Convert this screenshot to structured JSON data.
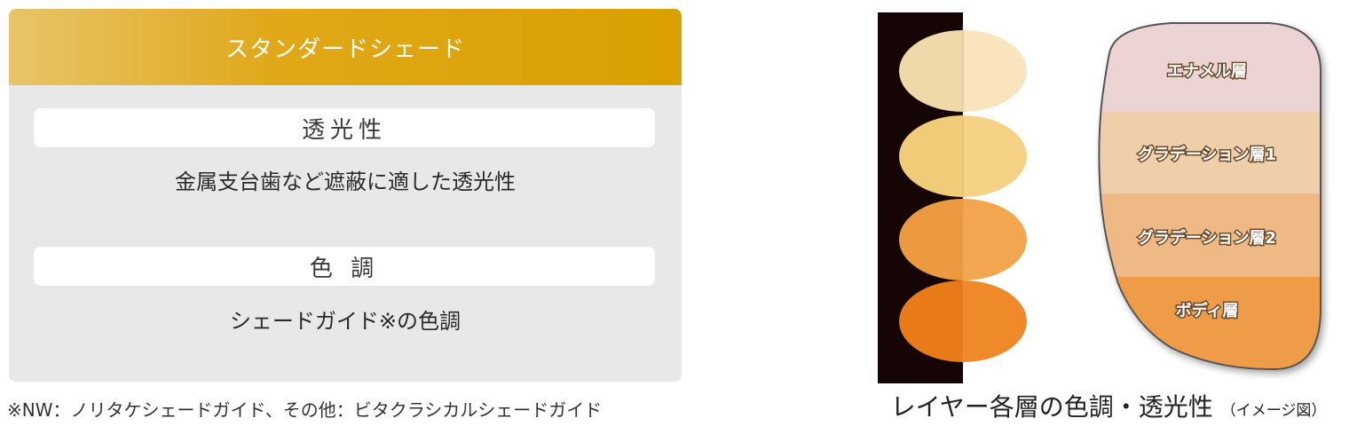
{
  "card": {
    "header": "スタンダードシェード",
    "sections": [
      {
        "label": "透光性",
        "description": "金属支台歯など遮蔽に適した透光性"
      },
      {
        "label": "色 調",
        "description": "シェードガイド※の色調"
      }
    ]
  },
  "footnote": "※NW：ノリタケシェードガイド、その他：ビタクラシカルシェードガイド",
  "diagram": {
    "layers": [
      "エナメル層",
      "グラデーション層1",
      "グラデーション層2",
      "ボディ層"
    ],
    "caption": "レイヤー各層の色調・透光性",
    "caption_note": "（イメージ図）",
    "colors": {
      "swatch_left": [
        "#f0d9a8",
        "#f0cc78",
        "#eb9a40",
        "#e87a18"
      ],
      "swatch_right": [
        "#f9e4bd",
        "#f6d286",
        "#f2a650",
        "#ef8a2a"
      ],
      "layer_fill": [
        "#edd4d4",
        "#efcfaa",
        "#efb985",
        "#ef9c48"
      ],
      "header_gold": "#dca81c"
    }
  }
}
